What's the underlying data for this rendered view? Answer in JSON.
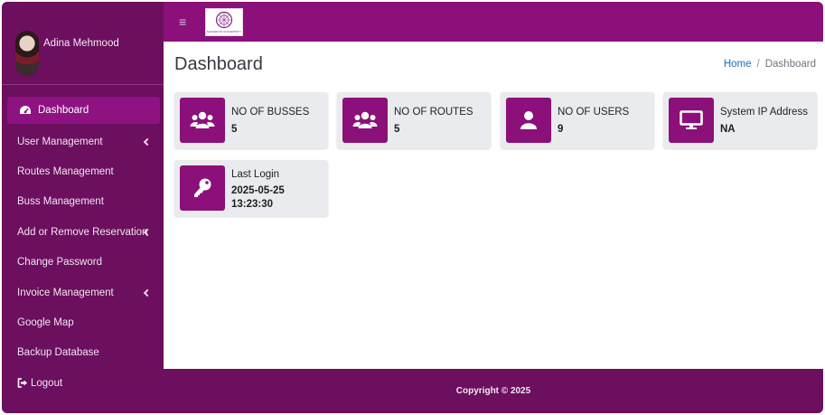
{
  "user": {
    "name": "Adina Mehmood"
  },
  "logo": {
    "text": "SUPERIOR UNIVERSITY"
  },
  "menu": [
    {
      "label": "Dashboard",
      "icon": "dashboard-gauge-icon",
      "active": true,
      "chevron": false
    },
    {
      "label": "User Management",
      "chevron": true
    },
    {
      "label": "Routes Management",
      "chevron": false
    },
    {
      "label": "Buss Management",
      "chevron": false
    },
    {
      "label": "Add or Remove Reservation",
      "chevron": true
    },
    {
      "label": "Change Password",
      "chevron": false
    },
    {
      "label": "Invoice Management",
      "chevron": true
    },
    {
      "label": "Google Map",
      "chevron": false
    },
    {
      "label": "Backup Database",
      "chevron": false
    },
    {
      "label": "Logout",
      "icon": "logout-icon",
      "chevron": false
    }
  ],
  "header": {
    "title": "Dashboard"
  },
  "breadcrumb": {
    "home": "Home",
    "separator": "/",
    "current": "Dashboard"
  },
  "cards": {
    "busses": {
      "label": "NO OF BUSSES",
      "value": "5",
      "icon": "users-group-icon"
    },
    "routes": {
      "label": "NO OF ROUTES",
      "value": "5",
      "icon": "users-group-icon"
    },
    "users": {
      "label": "NO OF USERS",
      "value": "9",
      "icon": "user-icon"
    },
    "ip": {
      "label": "System IP Address",
      "value": "NA",
      "icon": "monitor-icon"
    },
    "last_login": {
      "label": "Last Login",
      "date": "2025-05-25",
      "time": "13:23:30",
      "icon": "key-icon"
    }
  },
  "footer": {
    "text": "Copyright © 2025"
  },
  "colors": {
    "sidebar": "#6b0f5e",
    "topbar": "#8b1079",
    "accent": "#8e1282",
    "card_bg": "#e9ebee",
    "link": "#1f6fb5"
  }
}
